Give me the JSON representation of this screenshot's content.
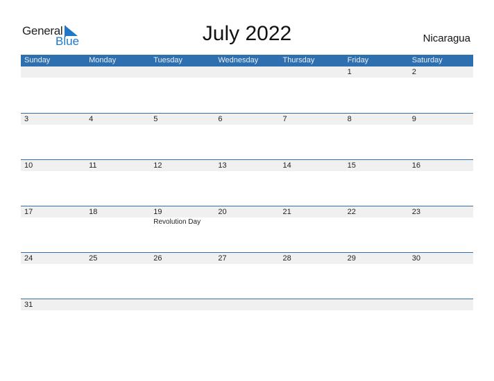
{
  "logo": {
    "word1": "General",
    "word2": "Blue",
    "brand_color": "#1f77c8"
  },
  "title": "July 2022",
  "country": "Nicaragua",
  "header_color": "#2e6fb0",
  "weekdays": [
    "Sunday",
    "Monday",
    "Tuesday",
    "Wednesday",
    "Thursday",
    "Friday",
    "Saturday"
  ],
  "weeks": [
    {
      "days": [
        "",
        "",
        "",
        "",
        "",
        "1",
        "2"
      ],
      "events": [
        "",
        "",
        "",
        "",
        "",
        "",
        ""
      ]
    },
    {
      "days": [
        "3",
        "4",
        "5",
        "6",
        "7",
        "8",
        "9"
      ],
      "events": [
        "",
        "",
        "",
        "",
        "",
        "",
        ""
      ]
    },
    {
      "days": [
        "10",
        "11",
        "12",
        "13",
        "14",
        "15",
        "16"
      ],
      "events": [
        "",
        "",
        "",
        "",
        "",
        "",
        ""
      ]
    },
    {
      "days": [
        "17",
        "18",
        "19",
        "20",
        "21",
        "22",
        "23"
      ],
      "events": [
        "",
        "",
        "Revolution Day",
        "",
        "",
        "",
        ""
      ]
    },
    {
      "days": [
        "24",
        "25",
        "26",
        "27",
        "28",
        "29",
        "30"
      ],
      "events": [
        "",
        "",
        "",
        "",
        "",
        "",
        ""
      ]
    },
    {
      "days": [
        "31",
        "",
        "",
        "",
        "",
        "",
        ""
      ],
      "events": [
        "",
        "",
        "",
        "",
        "",
        "",
        ""
      ]
    }
  ]
}
